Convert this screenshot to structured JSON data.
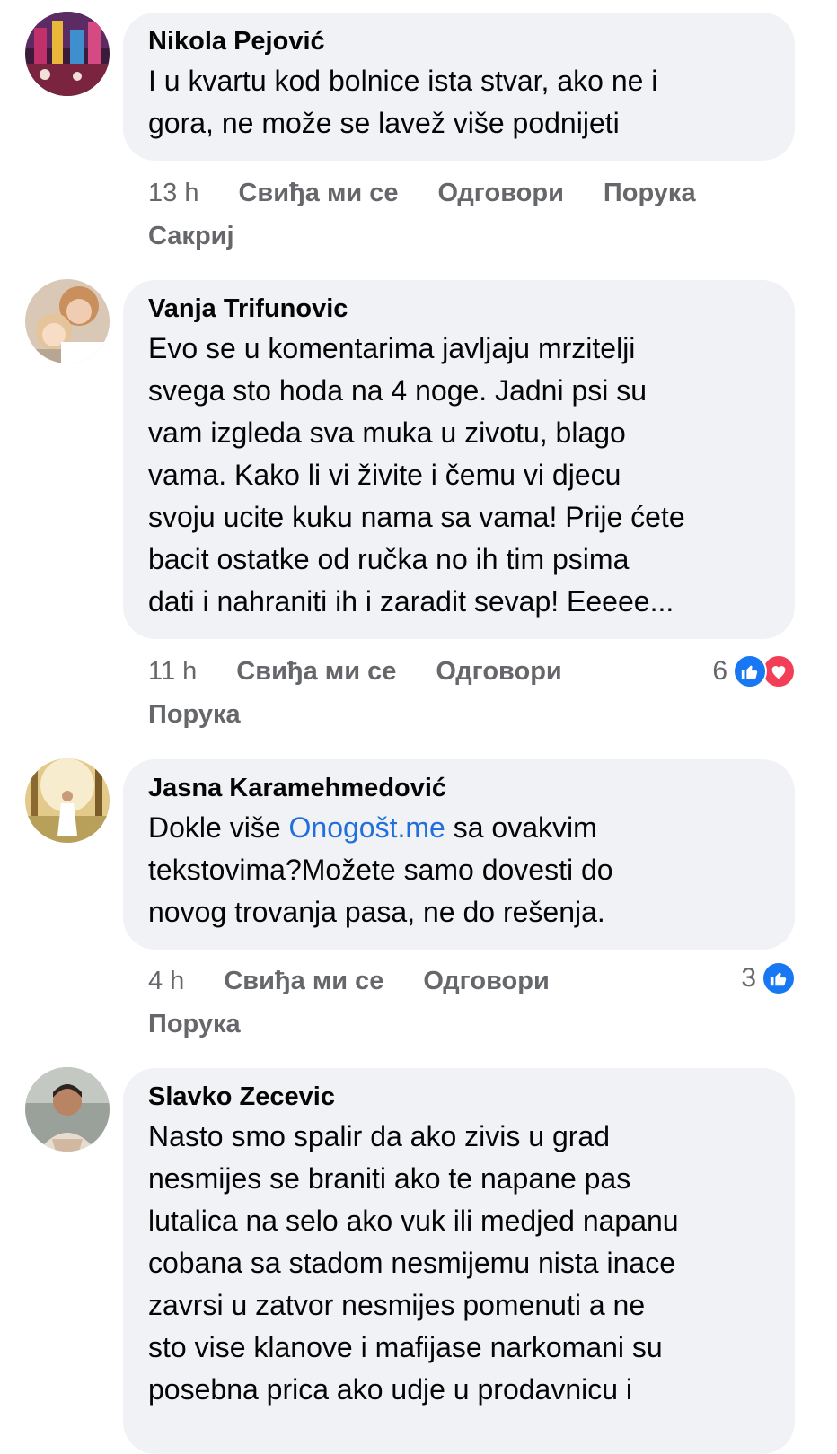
{
  "comments": [
    {
      "author": "Nikola Pejović",
      "text": "I u kvartu kod bolnice ista stvar, ako ne i\ngora, ne može se lavež više podnijeti",
      "time": "13 h",
      "like_label": "Свиђа ми се",
      "reply_label": "Одговори",
      "message_label": "Порука",
      "hide_label": "Сакриј"
    },
    {
      "author": "Vanja Trifunovic",
      "text": "Evo se u komentarima javljaju mrzitelji\nsvega sto hoda na 4 noge. Jadni psi su\nvam izgleda sva muka u zivotu, blago\nvama. Kako li vi živite i čemu vi djecu\nsvoju ucite kuku nama sa vama! Prije ćete\nbacit ostatke od ručka no ih tim psima\ndati i nahraniti ih i zaradit sevap! Eeeee...",
      "time": "11 h",
      "like_label": "Свиђа ми се",
      "reply_label": "Одговори",
      "message_label": "Порука",
      "reaction_count": "6",
      "reactions": [
        "like-icon",
        "love-icon"
      ]
    },
    {
      "author": "Jasna Karamehmedović",
      "text_before": "Dokle više ",
      "mention": "Onogošt.me",
      "text_after": " sa ovakvim\ntekstovima?Možete samo dovesti do\nnovog trovanja pasa, ne do rešenja.",
      "time": "4 h",
      "like_label": "Свиђа ми се",
      "reply_label": "Одговори",
      "message_label": "Порука",
      "reaction_count": "3",
      "reactions": [
        "like-icon"
      ]
    },
    {
      "author": "Slavko Zecevic",
      "text": "Nasto smo spalir da ako zivis u grad\nnesmijes se braniti ako te napane pas\nlutalica na selo ako vuk ili medjed napanu\ncobana sa stadom nesmijemu nista inace\nzavrsi u zatvor nesmijes pomenuti a ne\nsto vise klanove i mafijase narkomani su\nposebna prica ako udje u prodavnicu i"
    }
  ],
  "colors": {
    "bubble_bg": "#f0f2f5",
    "action_text": "#65676b",
    "mention": "#216fdb",
    "like_blue": "#1877f2",
    "love_red": "#f33e58"
  }
}
